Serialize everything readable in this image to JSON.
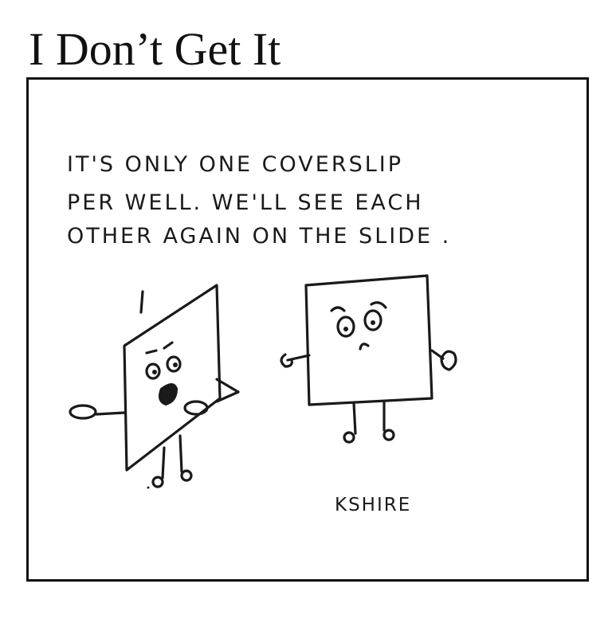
{
  "comic": {
    "title": "I Don’t Get It",
    "caption_lines": [
      "IT'S ONLY ONE COVERSLIP",
      "PER WELL. WE'LL SEE EACH",
      "OTHER AGAIN ON THE SLIDE ."
    ],
    "signature": "KSHIRE"
  }
}
